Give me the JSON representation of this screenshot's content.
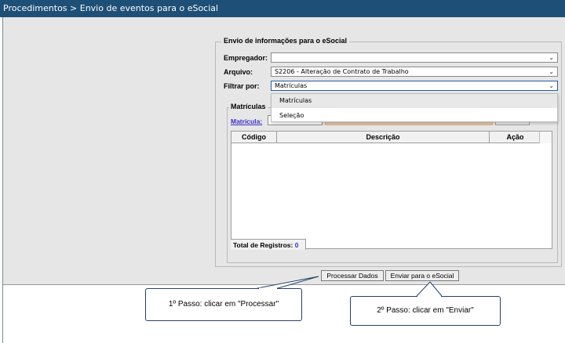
{
  "breadcrumb": "Procedimentos > Envio de eventos para o eSocial",
  "panel": {
    "legend": "Envio de informações para o eSocial",
    "empregador_label": "Empregador:",
    "empregador_value": "",
    "arquivo_label": "Arquivo:",
    "arquivo_value": "S2206 - Alteração de Contrato de Trabalho",
    "filtrar_label": "Filtrar por:",
    "filtrar_value": "Matrículas",
    "filtrar_options": [
      "Matrículas",
      "Seleção"
    ]
  },
  "matriculas": {
    "legend": "Matrículas",
    "field_label": "Matrícula:",
    "field_value": ""
  },
  "table": {
    "columns": [
      "Código",
      "Descrição",
      "Ação"
    ],
    "rows": [],
    "total_label": "Total de Registros:",
    "total_value": "0"
  },
  "buttons": {
    "processar": "Processar Dados",
    "enviar": "Enviar para o eSocial"
  },
  "callouts": {
    "step1": "1º Passo: clicar em \"Processar\"",
    "step2": "2º Passo: clicar em \"Enviar\""
  },
  "colors": {
    "title_bar": "#1e4f76",
    "panel_background": "#e6e6e6",
    "link_blue": "#3b2ec8",
    "callout_border": "#26416b"
  }
}
